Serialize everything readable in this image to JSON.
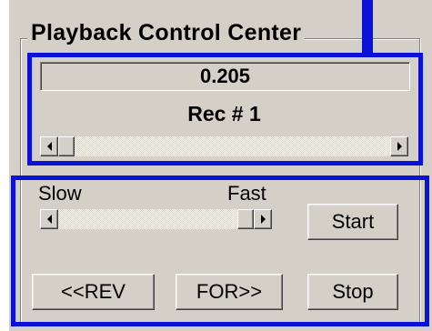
{
  "group": {
    "title": "Playback Control Center"
  },
  "playback": {
    "time_value": "0.205",
    "record_label": "Rec # 1",
    "record_scroll_position": 0.0
  },
  "speed": {
    "slow_label": "Slow",
    "fast_label": "Fast",
    "speed_position": 1.0
  },
  "buttons": {
    "start": "Start",
    "rev": "<<REV",
    "for": "FOR>>",
    "stop": "Stop"
  },
  "colors": {
    "panel": "#d4d0c8",
    "highlight_box": "#0a12d8"
  },
  "icons": {
    "scroll_left": "arrow-left-icon",
    "scroll_right": "arrow-right-icon"
  }
}
